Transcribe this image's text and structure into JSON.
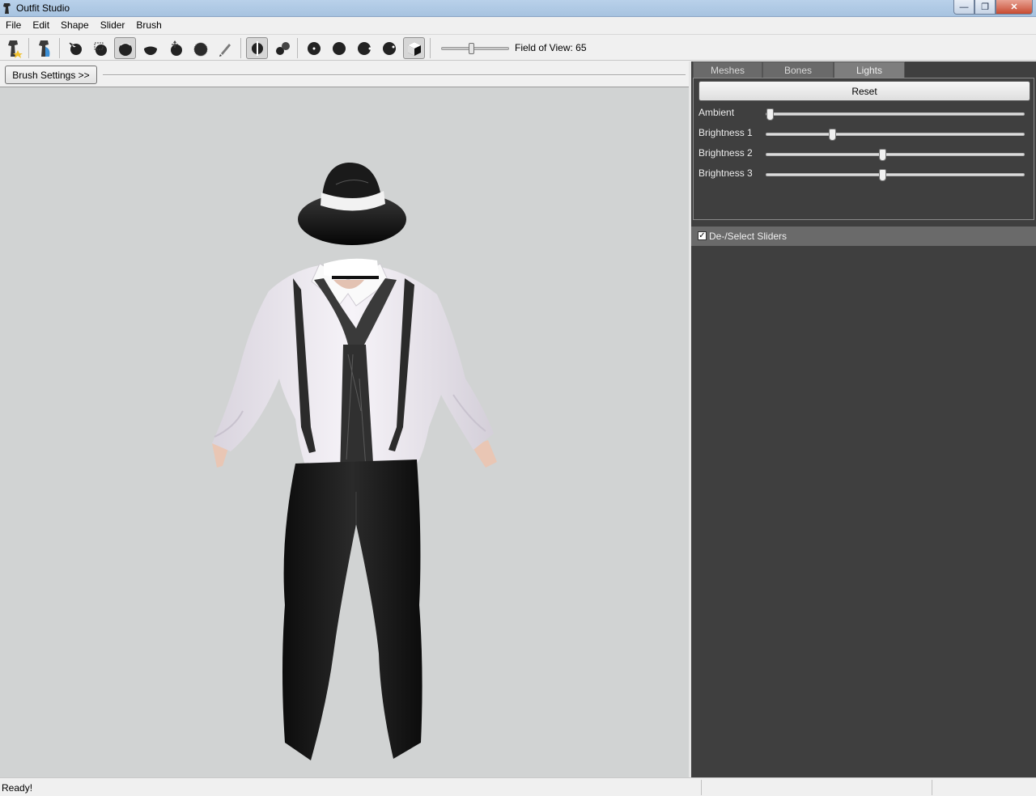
{
  "window": {
    "title": "Outfit Studio",
    "minimize_glyph": "—",
    "maximize_glyph": "❐",
    "close_glyph": "✕"
  },
  "menu": {
    "items": [
      "File",
      "Edit",
      "Shape",
      "Slider",
      "Brush"
    ]
  },
  "toolbar": {
    "field_of_view_label": "Field of View: 65",
    "field_of_view_slider_value": 65,
    "icons": [
      "new-project-icon",
      "load-outfit-icon",
      "select-brush-icon",
      "mask-brush-icon",
      "inflate-brush-icon",
      "deflate-brush-icon",
      "move-brush-icon",
      "smooth-brush-icon",
      "weight-brush-icon",
      "x-mirror-icon",
      "connected-only-icon",
      "brush-size-small-icon",
      "brush-size-medium-icon",
      "brush-size-large-icon",
      "brush-size-xlarge-icon",
      "shaded-view-icon"
    ]
  },
  "brush_bar": {
    "brush_settings_label": "Brush Settings >>"
  },
  "right_panel": {
    "tabs": [
      {
        "label": "Meshes",
        "active": false
      },
      {
        "label": "Bones",
        "active": false
      },
      {
        "label": "Lights",
        "active": true
      }
    ],
    "lights": {
      "reset_label": "Reset",
      "sliders": [
        {
          "label": "Ambient",
          "value_fraction": 0.0
        },
        {
          "label": "Brightness 1",
          "value_fraction": 0.25
        },
        {
          "label": "Brightness 2",
          "value_fraction": 0.45
        },
        {
          "label": "Brightness 3",
          "value_fraction": 0.45
        }
      ]
    },
    "sliders_section": {
      "checkbox_checked": true,
      "checkbox_glyph": "✓",
      "label": "De-/Select Sliders"
    }
  },
  "statusbar": {
    "text": "Ready!"
  },
  "colors": {
    "viewport_bg": "#d1d3d3",
    "panel_bg": "#3f3f3f",
    "tab_active": "#7e7e7e"
  }
}
